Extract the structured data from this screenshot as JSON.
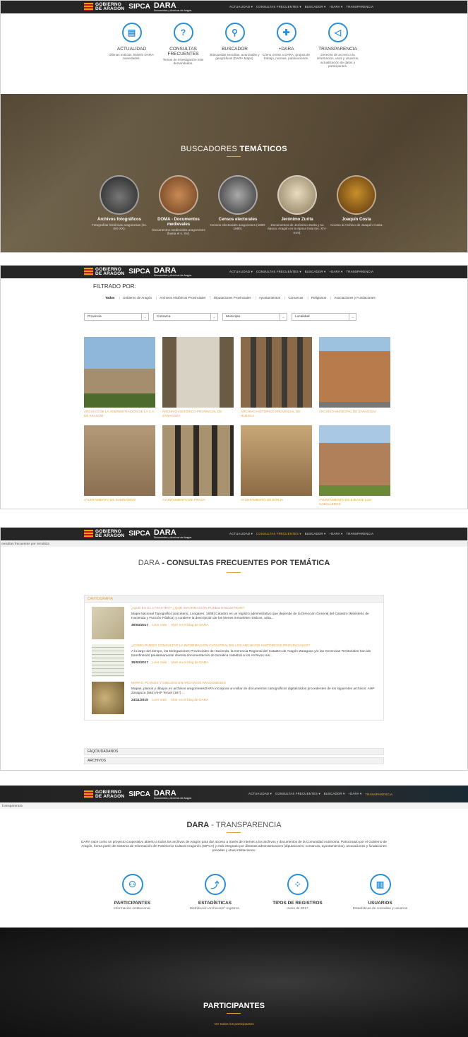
{
  "nav": {
    "gov_line1": "GOBIERNO",
    "gov_line2": "DE ARAGON",
    "sipca": "SIPCA",
    "dara": "DARA",
    "dara_sub": "Documentos y Archivos de Aragón",
    "menu": [
      "ACTUALIDAD ▾",
      "CONSULTAS FRECUENTES ▾",
      "BUSCADOR ▾",
      "+DARA ▾",
      "TRANSPARENCIA"
    ]
  },
  "home": {
    "icons": [
      {
        "title": "ACTUALIDAD",
        "desc": "Últimas noticias. Boletín DARA-Novedades."
      },
      {
        "title": "CONSULTAS FRECUENTES",
        "desc": "Temas de investigación más demandados."
      },
      {
        "title": "BUSCADOR",
        "desc": "Búsquedas sencillas, avanzadas y geográficas (DARA Maps)."
      },
      {
        "title": "+DARA",
        "desc": "Cómo unirse a DARA, grupos de trabajo, normas, publicaciones."
      },
      {
        "title": "TRANSPARENCIA",
        "desc": "Derecho de acceso a la información, usos y usuarios, actualización de datos y participantes."
      }
    ],
    "hero_title_a": "BUSCADORES",
    "hero_title_b": "TEMÁTICOS",
    "items": [
      {
        "title": "Archivos fotográficos",
        "desc": "Fotografías históricas aragonesas (ss. XIX-XX)."
      },
      {
        "title": "DOMA - Documentos medievales",
        "desc": "Documentos medievales aragoneses (hasta el s. XV)."
      },
      {
        "title": "Censos electorales",
        "desc": "Censos electorales aragoneses (1890-1950)."
      },
      {
        "title": "Jerónimo Zurita",
        "desc": "Documentos de Jerónimo Zurita y su época. Aragón en la época foral (ss. XIV-XVII)."
      },
      {
        "title": "Joaquín Costa",
        "desc": "Acceso al Archivo de Joaquín Costa."
      }
    ]
  },
  "archives": {
    "filter_heading": "FILTRADO POR:",
    "filters": [
      "Todos",
      "Gobierno de Aragón",
      "Archivos Históricos Provinciales",
      "Diputaciones Provinciales",
      "Ayuntamientos",
      "Comarcas",
      "Religiosos",
      "Asociaciones y Fundaciones"
    ],
    "selects": [
      "Provincia",
      "Comarca",
      "Municipio",
      "Localidad"
    ],
    "cards": [
      "ARCHIVO DE LA ADMINISTRACIÓN DE LA C.A. DE ARAGÓN",
      "ARCHIVO HISTÓRICO PROVINCIAL DE ZARAGOZA",
      "ARCHIVO HISTÓRICO PROVINCIAL DE HUESCA",
      "ARCHIVO MUNICIPAL DE ZARAGOZA",
      "AYUNTAMIENTO DE SABIÑÁNIGO",
      "AYUNTAMIENTO DE FRAGA",
      "AYUNTAMIENTO DE BORJA",
      "AYUNTAMIENTO DE EJEA DE LOS CABALLEROS"
    ]
  },
  "faq": {
    "breadcrumb": "onsultas frecuentes por temática",
    "title_a": "DARA",
    "title_sep": " - ",
    "title_b": "CONSULTAS FRECUENTES POR TEMÁTICA",
    "section": "CARTOGRAFÍA",
    "entries": [
      {
        "title": "¿QUÉ ES EL CATASTRO? ¿QUÉ INFORMACIÓN PUEDO ENCONTRAR?",
        "desc": "Mapa Nacional Topográfico parcelario. Longares. 1938] Catastro es un registro administrativo que depende de la Dirección General del Catastro (Ministerio de Hacienda y Función Pública) y contiene la descripción de los bienes inmuebles rústicos, urba...",
        "date": "30/03/2017",
        "more": "Leer más",
        "blog": "Abrir en el blog de DARA"
      },
      {
        "title": "¿CÓMO PUEDO CONSULTAR LA INFORMACIÓN CATASTRAL EN LOS ARCHIVOS HISTÓRICOS PROVINCIALES?",
        "desc": "A lo largo del tiempo, las Delegaciones Provinciales de Hacienda, la Gerencia Regional del Catastro de Aragón-Zaragoza y/o las Gerencias Territoriales han ido transfiriendo paulatinamente diversa documentación de temática catastral a los Archivos His...",
        "date": "30/03/2017",
        "more": "Leer más",
        "blog": "Abrir en el blog de DARA"
      },
      {
        "title": "MAPAS, PLANOS Y DIBUJOS EN ARCHIVOS ARAGONESES",
        "desc": "Mapas, planos y dibujos en archivos aragonesesDARA incorpora un millar de documentos cartográficos digitalizados procedentes de los siguientes archivos: AHP Zaragoza (564) AHP Teruel (187) ...",
        "date": "24/11/2015",
        "more": "Leer más",
        "blog": "Abrir en el blog de DARA"
      }
    ],
    "sections_collapsed": [
      "FAQCIUDADANOS",
      "ARCHIVOS"
    ]
  },
  "transparency": {
    "breadcrumb": "Transparencia",
    "title_a": "DARA",
    "title_b": " - TRANSPARENCIA",
    "intro": "DARA nace como un proyecto cooperativo abierto a todos los archivos de Aragón para dar acceso a través de internet a los archivos y documentos de la Comunidad Autónoma. Patrocinado por el Gobierno de Aragón, forma parte del Sistema de Información del Patrimonio Cultural Aragonés (SIPCA) y está integrado por distintas administraciones (diputaciones, comarcas, ayuntamientos), asociaciones y fundaciones privadas y otras instituciones.",
    "icons": [
      {
        "title": "PARTICIPANTES",
        "desc": "Información institucional."
      },
      {
        "title": "ESTADÍSTICAS",
        "desc": "Distribución Archivos/nº registros."
      },
      {
        "title": "TIPOS DE REGISTROS",
        "desc": "Junio de 2017"
      },
      {
        "title": "USUARIOS",
        "desc": "Estadísticas de consultas y usuarios"
      }
    ],
    "band_title": "PARTICIPANTES",
    "band_link": "Ver todos los participantes"
  },
  "colors": {
    "accent": "#e8a33d",
    "icon_blue": "#2b8fd6",
    "nav_bg": "#262626"
  }
}
